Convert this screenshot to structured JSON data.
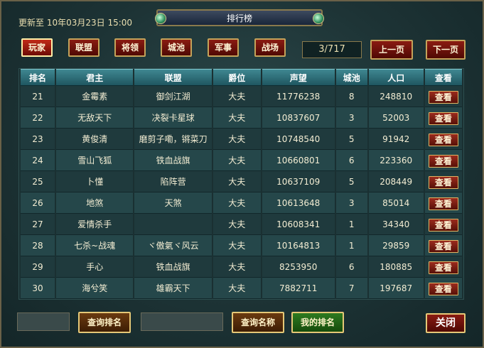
{
  "header": {
    "update_text": "更新至 10年03月23日 15:00",
    "title": "排行榜"
  },
  "categories": [
    "玩家",
    "联盟",
    "将领",
    "城池",
    "军事",
    "战场"
  ],
  "active_category": "玩家",
  "pagination": {
    "indicator": "3/717",
    "prev_label": "上一页",
    "next_label": "下一页"
  },
  "table": {
    "columns": [
      "排名",
      "君主",
      "联盟",
      "爵位",
      "声望",
      "城池",
      "人口",
      "查看"
    ],
    "rows": [
      [
        "21",
        "金霉素",
        "御剑江湖",
        "大夫",
        "11776238",
        "8",
        "248810",
        "查看"
      ],
      [
        "22",
        "无敌天下",
        "决裂卡星球",
        "大夫",
        "10837607",
        "3",
        "52003",
        "查看"
      ],
      [
        "23",
        "黄俊清",
        "磨剪子嘞，锵菜刀",
        "大夫",
        "10748540",
        "5",
        "91942",
        "查看"
      ],
      [
        "24",
        "雪山飞狐",
        "铁血战旗",
        "大夫",
        "10660801",
        "6",
        "223360",
        "查看"
      ],
      [
        "25",
        "卜懂",
        "陷阵营",
        "大夫",
        "10637109",
        "5",
        "208449",
        "查看"
      ],
      [
        "26",
        "地煞",
        "天煞",
        "大夫",
        "10613648",
        "3",
        "85014",
        "查看"
      ],
      [
        "27",
        "爱情杀手",
        "",
        "大夫",
        "10608341",
        "1",
        "34340",
        "查看"
      ],
      [
        "28",
        "七杀~战魂",
        "ヾ傲氣ヾ风云",
        "大夫",
        "10164813",
        "1",
        "29859",
        "查看"
      ],
      [
        "29",
        "手心",
        "铁血战旗",
        "大夫",
        "8253950",
        "6",
        "180885",
        "查看"
      ],
      [
        "30",
        "海兮笑",
        "雄霸天下",
        "大夫",
        "7882711",
        "7",
        "197687",
        "查看"
      ]
    ]
  },
  "footer": {
    "search_rank_label": "查询排名",
    "search_name_label": "查询名称",
    "my_rank_label": "我的排名",
    "close_label": "关闭",
    "rank_input_value": "",
    "name_input_value": ""
  },
  "colors": {
    "button_red": "#8a1b12",
    "header_teal": "#3f8791",
    "gold_border": "#c4a35a"
  }
}
